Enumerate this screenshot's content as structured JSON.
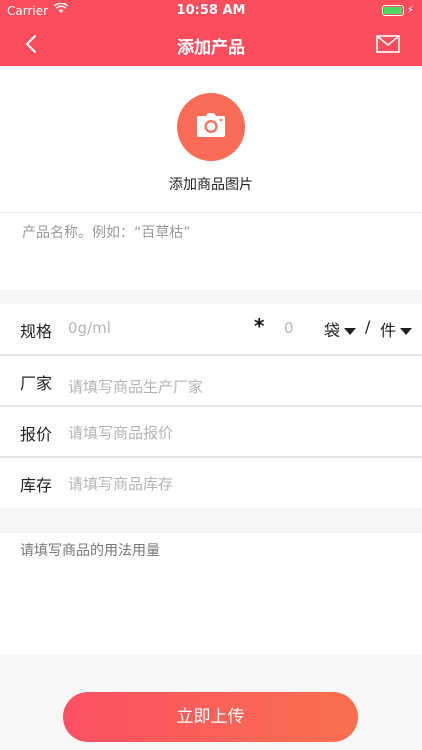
{
  "status_bar": {
    "carrier": "Carrier",
    "time": "10:58 AM"
  },
  "nav": {
    "title": "添加产品"
  },
  "photo": {
    "label": "添加商品图片"
  },
  "name_field": {
    "placeholder": "产品名称。例如：“百草枯”"
  },
  "spec_row": {
    "label": "规格",
    "placeholder": "0g/ml",
    "star": "*",
    "quantity_placeholder": "0",
    "unit_1": "袋",
    "slash": "/",
    "unit_2": "件"
  },
  "manufacturer_row": {
    "label": "厂家",
    "placeholder": "请填写商品生产厂家"
  },
  "price_row": {
    "label": "报价",
    "placeholder": "请填写商品报价"
  },
  "stock_row": {
    "label": "库存",
    "placeholder": "请填写商品库存"
  },
  "usage_field": {
    "placeholder": "请填写商品的用法用量"
  },
  "submit": {
    "label": "立即上传"
  },
  "colors": {
    "accent": "#fc4d5d",
    "camera": "#fb6c57",
    "battery": "#4cd964"
  }
}
